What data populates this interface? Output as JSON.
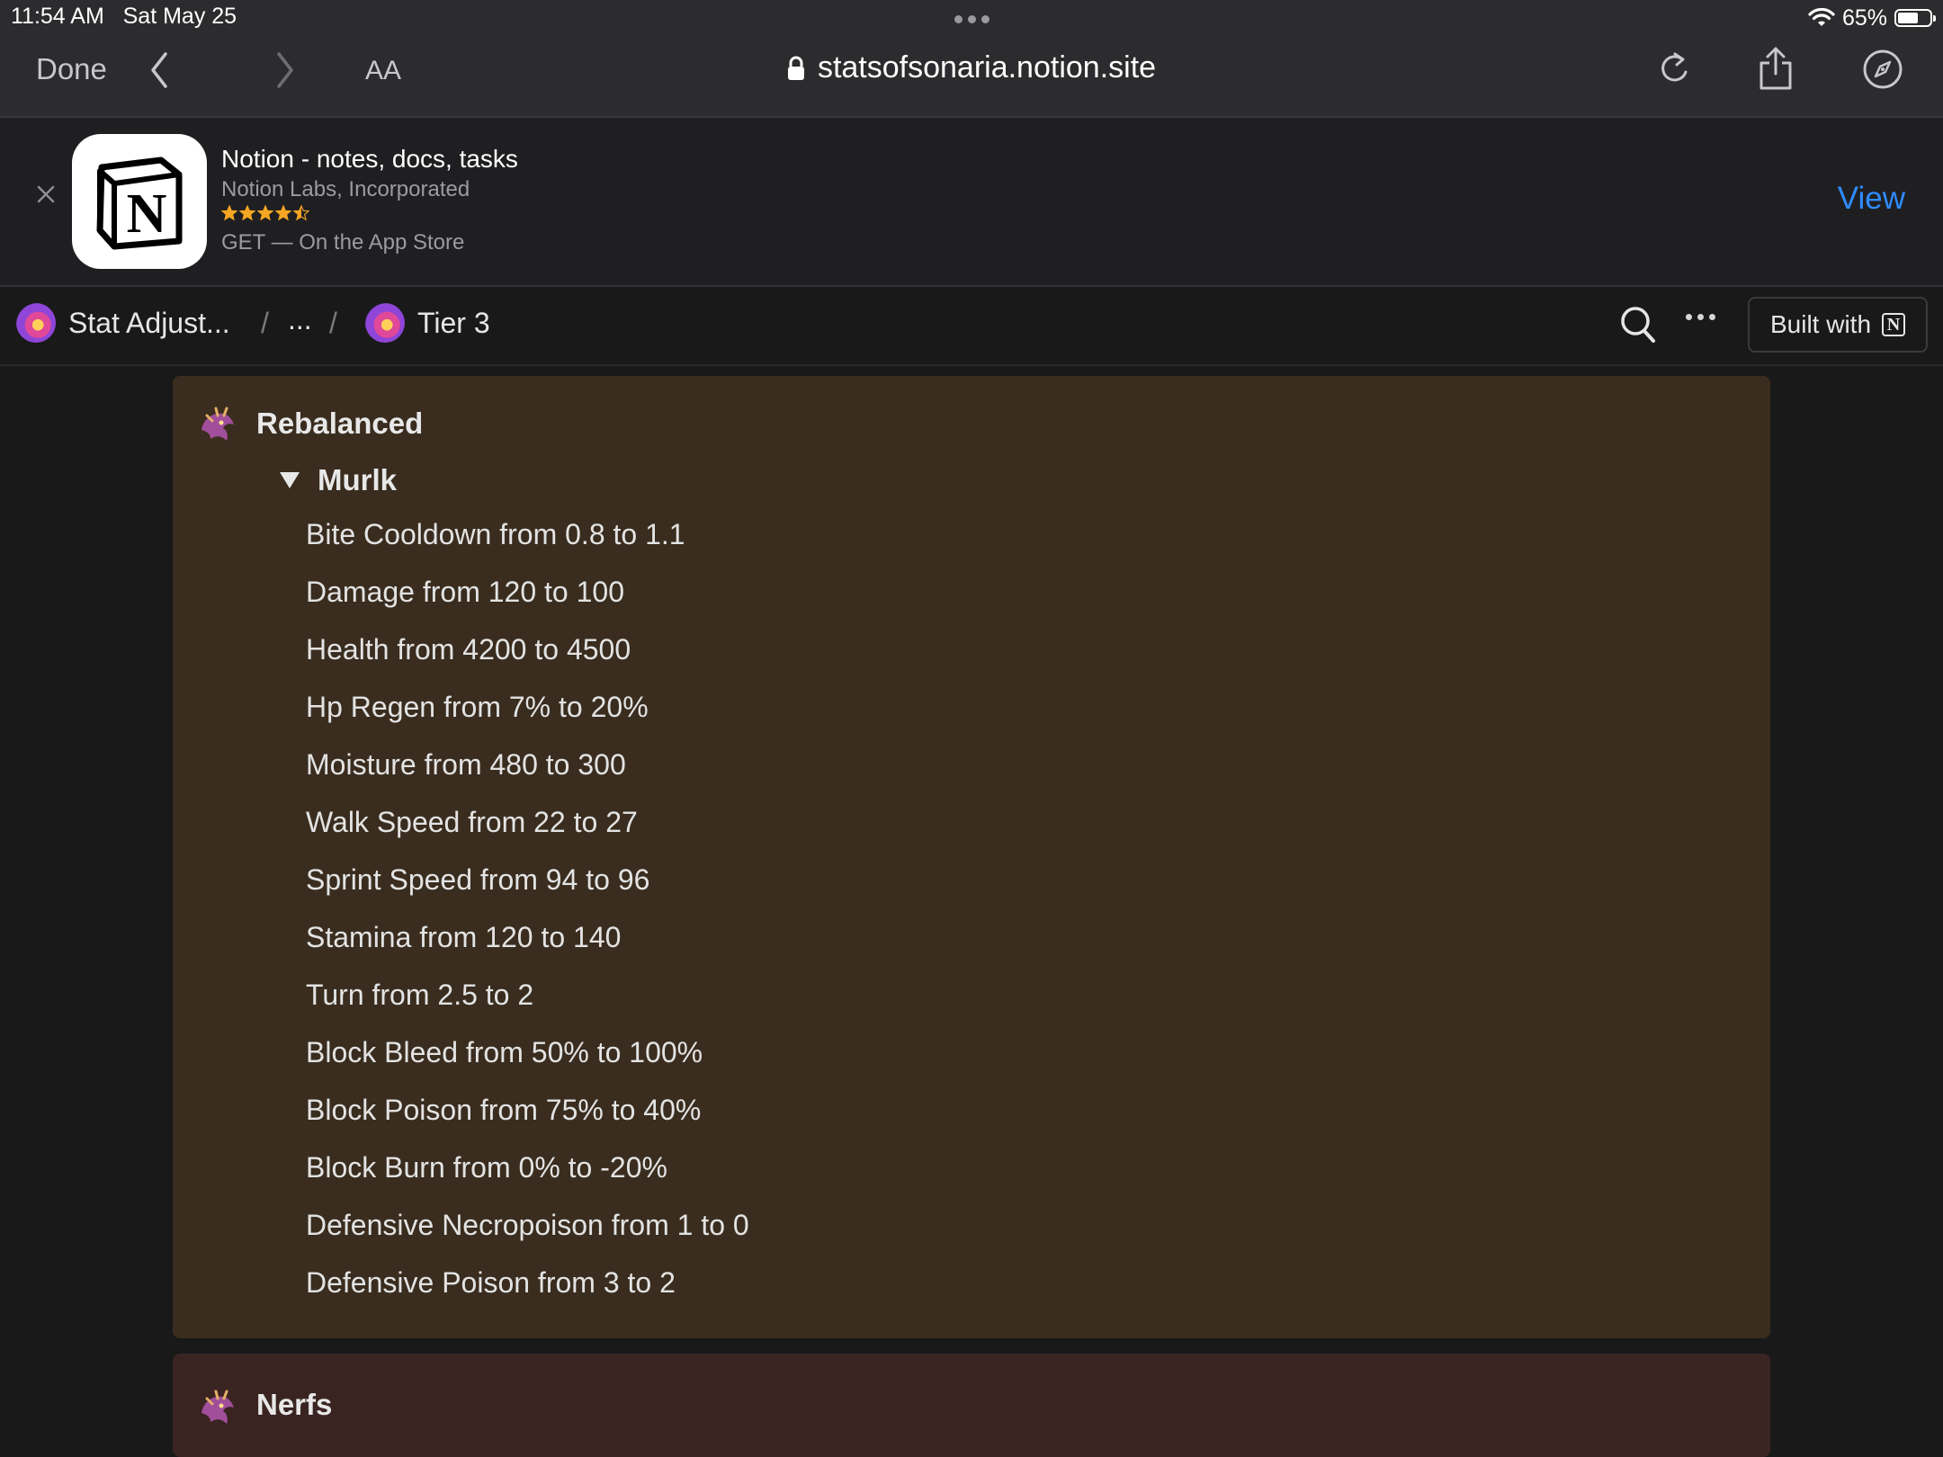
{
  "status_bar": {
    "time": "11:54 AM",
    "date": "Sat May 25",
    "battery": "65%",
    "battery_level": 0.65
  },
  "browser": {
    "done_label": "Done",
    "text_size_label": "AA",
    "url": "statsofsonaria.notion.site",
    "icons": [
      "back-icon",
      "forward-icon",
      "lock-icon",
      "reload-icon",
      "share-icon",
      "compass-icon"
    ]
  },
  "app_banner": {
    "app_name": "Notion - notes, docs, tasks",
    "developer": "Notion Labs, Incorporated",
    "rating": 4.5,
    "get_text": "GET — On the App Store",
    "view_label": "View",
    "accent_color": "#2f8cff"
  },
  "notion_topbar": {
    "breadcrumb": [
      "Stat Adjust...",
      "...",
      "Tier 3"
    ],
    "separator": "/",
    "built_with_label": "Built with"
  },
  "content": {
    "rebalanced": {
      "title": "Rebalanced",
      "bg_color": "#3a2d1f",
      "toggle": {
        "label": "Murlk",
        "items": [
          "Bite Cooldown from 0.8 to 1.1",
          "Damage from 120 to 100",
          "Health from 4200 to 4500",
          "Hp Regen from 7% to 20%",
          "Moisture from 480 to 300",
          "Walk Speed from 22 to 27",
          "Sprint Speed from 94 to 96",
          "Stamina from 120 to 140",
          "Turn from 2.5 to 2",
          "Block Bleed from 50% to 100%",
          "Block Poison from 75% to 40%",
          "Block Burn from 0% to -20%",
          "Defensive Necropoison from 1 to 0",
          "Defensive Poison from 3 to 2"
        ]
      }
    },
    "nerfs": {
      "title": "Nerfs",
      "bg_color": "#3a2422"
    }
  }
}
